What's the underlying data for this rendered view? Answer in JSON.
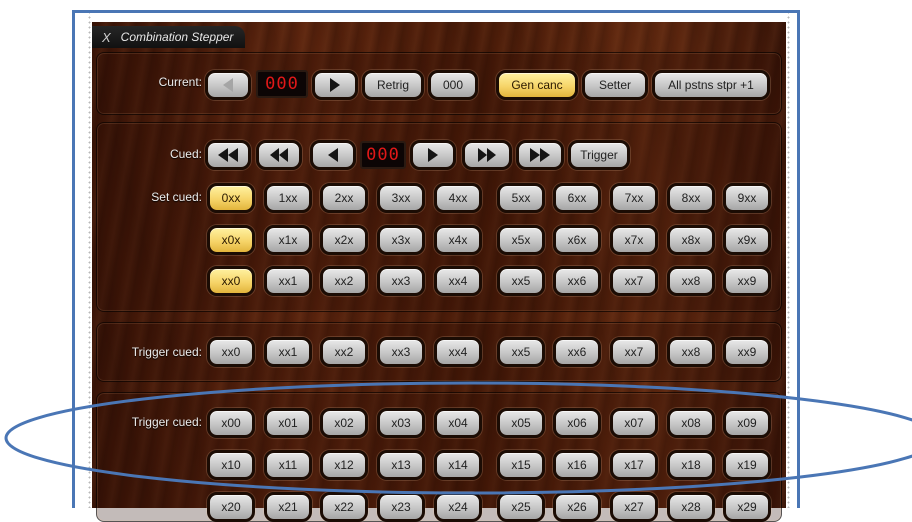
{
  "window": {
    "close_glyph": "X",
    "title": "Combination Stepper"
  },
  "current": {
    "label": "Current:",
    "display": "000",
    "retrig": "Retrig",
    "zero": "000",
    "gen_canc": "Gen canc",
    "setter": "Setter",
    "all_pistons": "All pstns stpr +1"
  },
  "cued": {
    "label": "Cued:",
    "display": "000",
    "trigger": "Trigger",
    "icons": [
      "step-back-100-icon",
      "step-back-10-icon",
      "step-back-1-icon",
      "step-forward-1-icon",
      "step-forward-10-icon",
      "step-forward-100-icon"
    ]
  },
  "set_cued": {
    "label": "Set cued:",
    "rows": [
      [
        "0xx",
        "1xx",
        "2xx",
        "3xx",
        "4xx",
        "5xx",
        "6xx",
        "7xx",
        "8xx",
        "9xx"
      ],
      [
        "x0x",
        "x1x",
        "x2x",
        "x3x",
        "x4x",
        "x5x",
        "x6x",
        "x7x",
        "x8x",
        "x9x"
      ],
      [
        "xx0",
        "xx1",
        "xx2",
        "xx3",
        "xx4",
        "xx5",
        "xx6",
        "xx7",
        "xx8",
        "xx9"
      ]
    ],
    "active_column": 0
  },
  "trigger_cued_1": {
    "label": "Trigger cued:",
    "buttons": [
      "xx0",
      "xx1",
      "xx2",
      "xx3",
      "xx4",
      "xx5",
      "xx6",
      "xx7",
      "xx8",
      "xx9"
    ]
  },
  "trigger_cued_2": {
    "label": "Trigger cued:",
    "rows": [
      [
        "x00",
        "x01",
        "x02",
        "x03",
        "x04",
        "x05",
        "x06",
        "x07",
        "x08",
        "x09"
      ],
      [
        "x10",
        "x11",
        "x12",
        "x13",
        "x14",
        "x15",
        "x16",
        "x17",
        "x18",
        "x19"
      ],
      [
        "x20",
        "x21",
        "x22",
        "x23",
        "x24",
        "x25",
        "x26",
        "x27",
        "x28",
        "x29"
      ]
    ]
  },
  "colors": {
    "frame": "#4a76b5",
    "annotation_ellipse": "#4a76b5",
    "button_active": "#f6d56a",
    "display_text": "#e01818"
  }
}
